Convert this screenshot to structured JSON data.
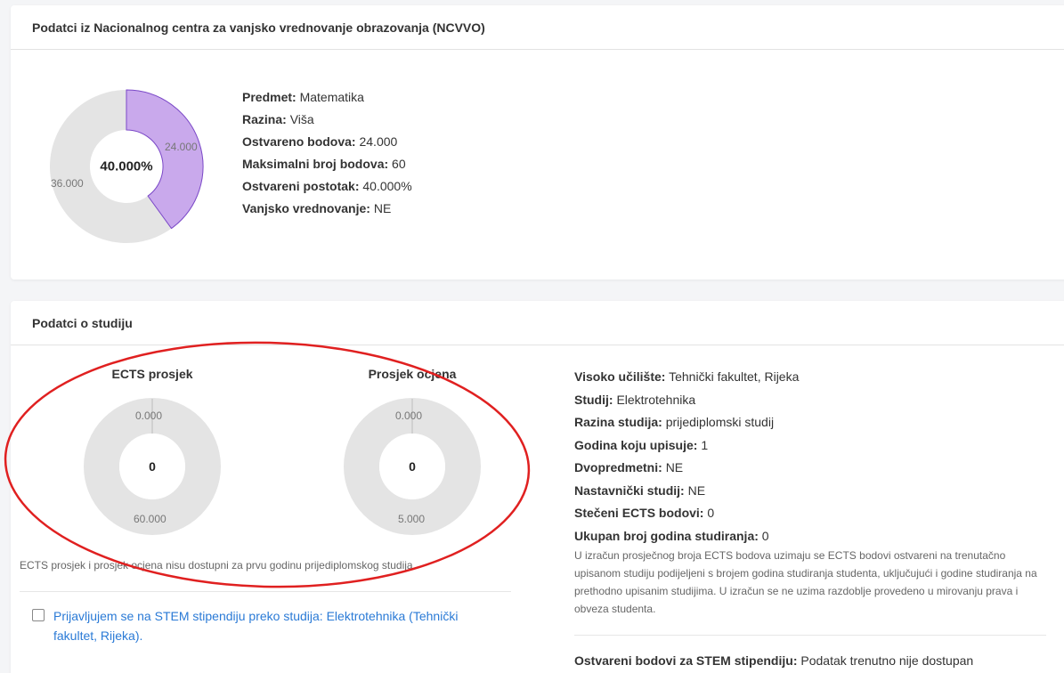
{
  "ncvvo": {
    "title": "Podatci iz Nacionalnog centra za vanjsko vrednovanje obrazovanja (NCVVO)",
    "chart": {
      "center": "40.000%",
      "achieved_label": "24.000",
      "remaining_label": "36.000",
      "achieved_fraction": 0.4,
      "achieved_color": "#c9a9ec",
      "achieved_stroke": "#7a48c7",
      "remaining_color": "#e4e4e4"
    },
    "info": [
      {
        "label": "Predmet:",
        "value": "Matematika"
      },
      {
        "label": "Razina:",
        "value": "Viša"
      },
      {
        "label": "Ostvareno bodova:",
        "value": "24.000"
      },
      {
        "label": "Maksimalni broj bodova:",
        "value": "60"
      },
      {
        "label": "Ostvareni postotak:",
        "value": "40.000%"
      },
      {
        "label": "Vanjsko vrednovanje:",
        "value": "NE"
      }
    ]
  },
  "study": {
    "title": "Podatci o studiju",
    "ects": {
      "title": "ECTS prosjek",
      "top_label": "0.000",
      "bottom_label": "60.000",
      "center": "0"
    },
    "grade": {
      "title": "Prosjek ocjena",
      "top_label": "0.000",
      "bottom_label": "5.000",
      "center": "0"
    },
    "unavailable_note": "ECTS prosjek i prosjek ocjena nisu dostupni za prvu godinu prijediplomskog studija.",
    "stem_checkbox_label": "Prijavljujem se na STEM stipendiju preko studija: Elektrotehnika (Tehnički fakultet, Rijeka).",
    "info": [
      {
        "label": "Visoko učilište:",
        "value": "Tehnički fakultet, Rijeka"
      },
      {
        "label": "Studij:",
        "value": "Elektrotehnika"
      },
      {
        "label": "Razina studija:",
        "value": "prijediplomski studij"
      },
      {
        "label": "Godina koju upisuje:",
        "value": "1"
      },
      {
        "label": "Dvopredmetni:",
        "value": "NE"
      },
      {
        "label": "Nastavnički studij:",
        "value": "NE"
      },
      {
        "label": "Stečeni ECTS bodovi:",
        "value": "0"
      },
      {
        "label": "Ukupan broj godina studiranja:",
        "value": "0"
      }
    ],
    "ects_note": "U izračun prosječnog broja ECTS bodova uzimaju se ECTS bodovi ostvareni na trenutačno upisanom studiju podijeljeni s brojem godina studiranja studenta, uključujući i godine studiranja na prethodno upisanim studijima. U izračun se ne uzima razdoblje provedeno u mirovanju prava i obveza studenta.",
    "stem_points": {
      "label": "Ostvareni bodovi za STEM stipendiju:",
      "value": "Podatak trenutno nije dostupan"
    }
  },
  "annotation_color": "#e02020"
}
